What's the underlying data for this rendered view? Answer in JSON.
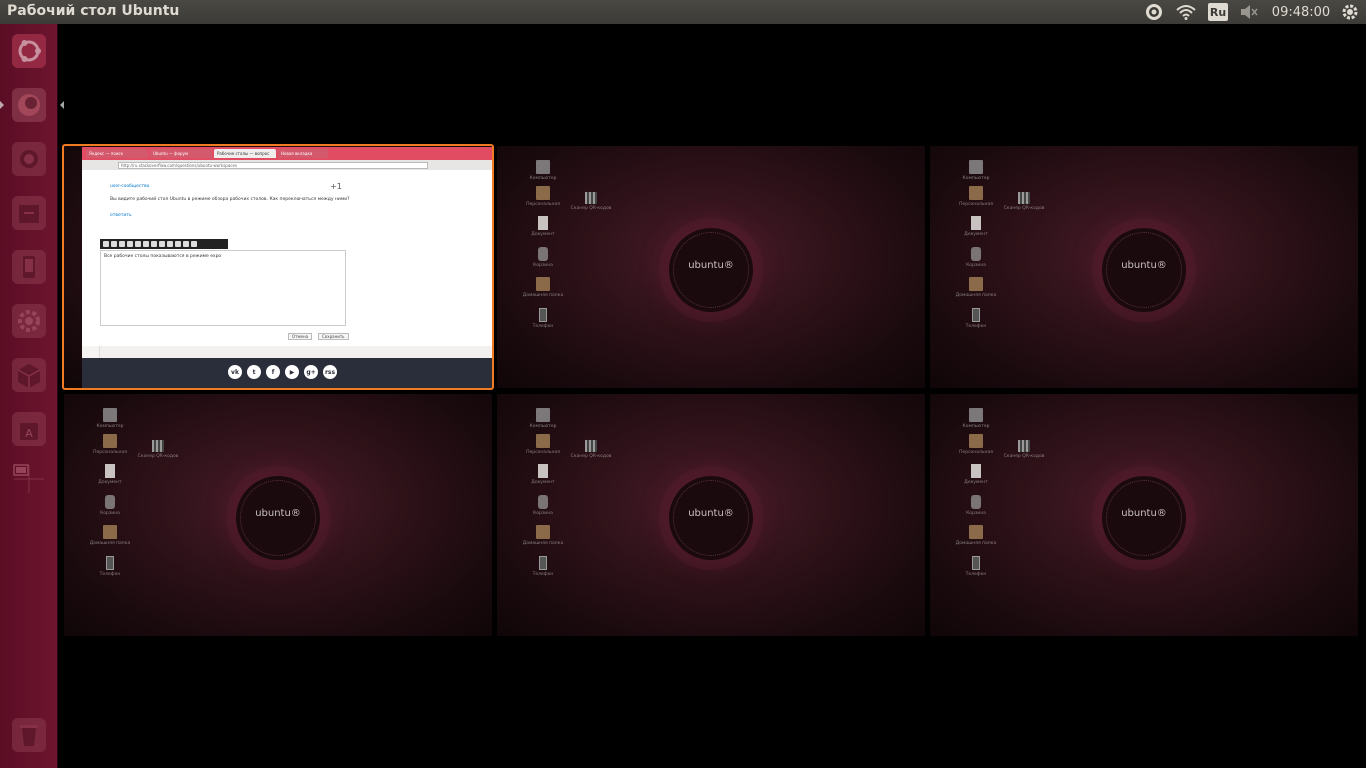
{
  "panel": {
    "title": "Рабочий стол Ubuntu",
    "keyboard_layout": "Ru",
    "clock": "09:48:00"
  },
  "launcher": {
    "items": [
      {
        "name": "dash-home",
        "icon": "ubuntu-logo-icon"
      },
      {
        "name": "firefox",
        "icon": "firefox-icon"
      },
      {
        "name": "system-settings",
        "icon": "camera-icon"
      },
      {
        "name": "files",
        "icon": "file-cabinet-icon"
      },
      {
        "name": "mobile",
        "icon": "phone-icon"
      },
      {
        "name": "settings",
        "icon": "gear-icon"
      },
      {
        "name": "software",
        "icon": "box-icon"
      },
      {
        "name": "software-center",
        "icon": "bag-icon"
      },
      {
        "name": "workspace-switcher",
        "icon": "workspace-icon"
      },
      {
        "name": "trash",
        "icon": "trash-icon"
      }
    ]
  },
  "workspaces": {
    "brand": "ubuntu®",
    "desktop_icons": [
      "Компьютер",
      "Персональная",
      "Документ",
      "Корзина",
      "Домашняя папка",
      "Телефон"
    ],
    "qr_label": "Сканер QR-кодов"
  },
  "browser": {
    "tabs": [
      "Яндекс — поиск",
      "Ubuntu — форум",
      "Рабочие столы — вопрос",
      "Новая вкладка"
    ],
    "url": "http://ru.stackoverflow.com/questions/ubuntu-workspaces",
    "comment_author": "user-сообщество",
    "vote": "+1",
    "comment_text": "Вы видите рабочий стол Ubuntu в режиме обзора рабочих столов. Как переключаться между ними?",
    "more_link": "ответить",
    "editor_text": "Все рабочие столы показываются в режиме expo",
    "cancel_label": "Отмена",
    "save_label": "Сохранить",
    "social_icons": [
      "vk-icon",
      "twitter-icon",
      "facebook-icon",
      "youtube-icon",
      "googleplus-icon",
      "rss-icon"
    ],
    "social_glyphs": [
      "vk",
      "t",
      "f",
      "▶",
      "g+",
      "rss"
    ]
  },
  "colors": {
    "launcher": "#6e1530",
    "active_border": "#f07b22",
    "panel": "#3c3b37"
  }
}
